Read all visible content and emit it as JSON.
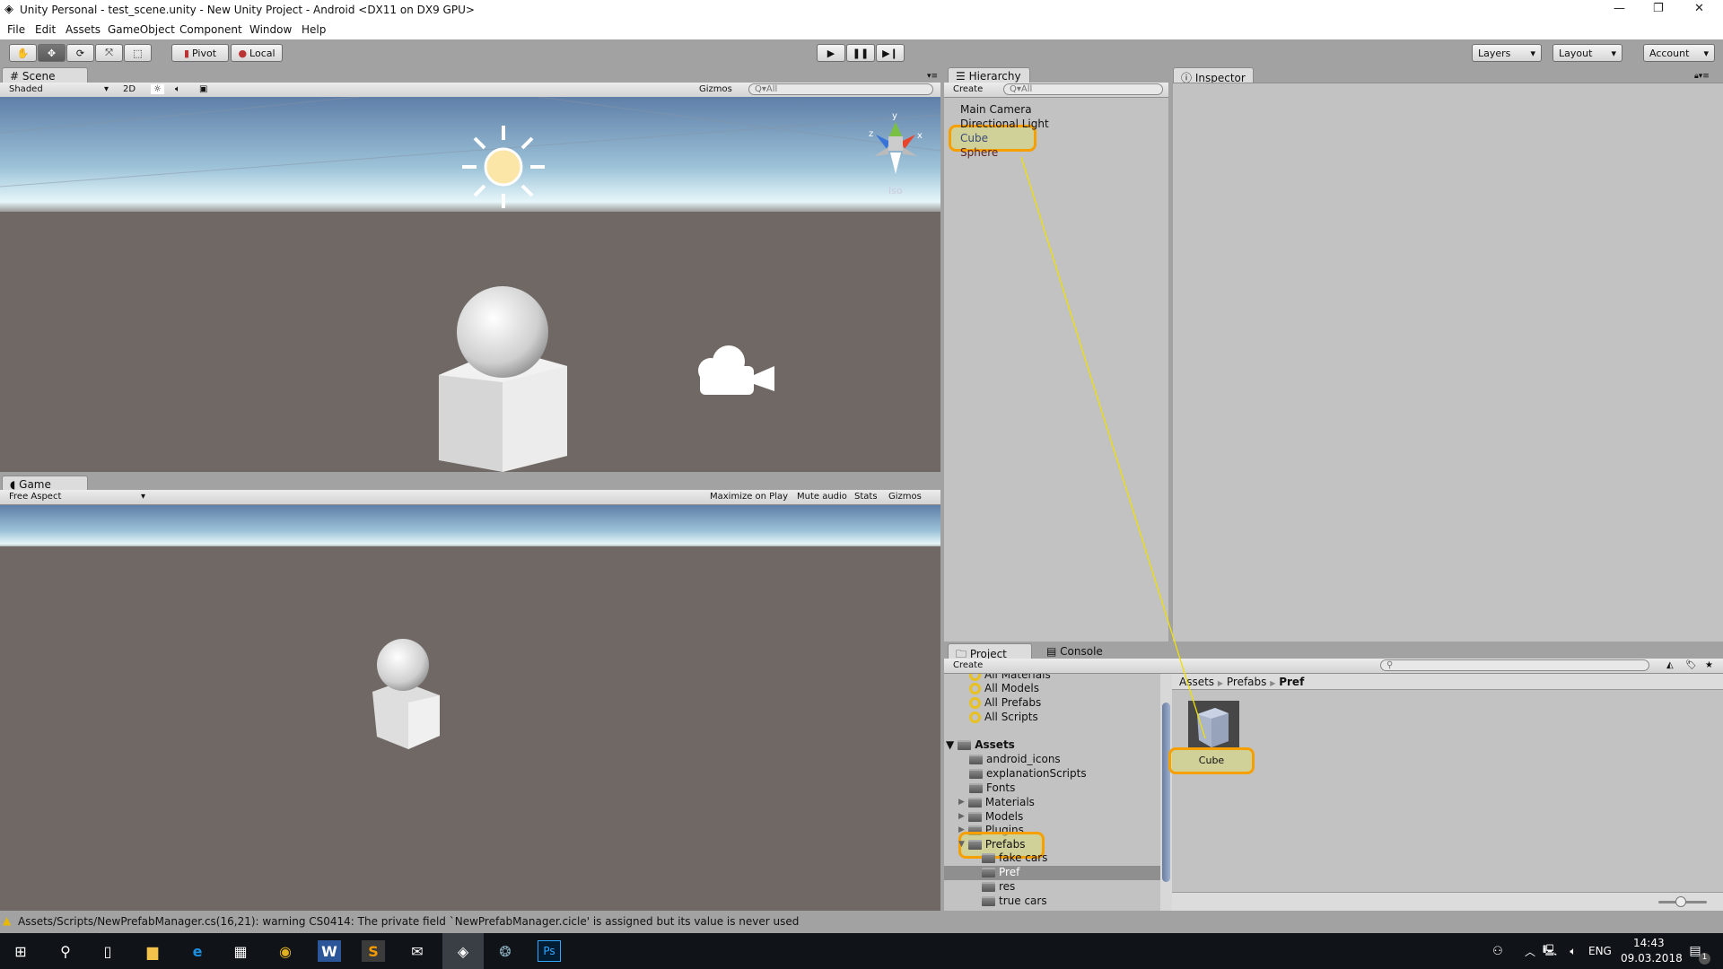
{
  "window": {
    "title": "Unity Personal - test_scene.unity - New Unity Project - Android <DX11 on DX9 GPU>",
    "minimize": "—",
    "restore": "❐",
    "close": "✕"
  },
  "menu": [
    "File",
    "Edit",
    "Assets",
    "GameObject",
    "Component",
    "Window",
    "Help"
  ],
  "toolbar": {
    "pivot": "Pivot",
    "local": "Local",
    "layers": "Layers",
    "layout": "Layout",
    "account": "Account"
  },
  "scene": {
    "tab": "Scene",
    "shading": "Shaded",
    "mode2d": "2D",
    "gizmos": "Gizmos",
    "search_placeholder": "All",
    "gizmo_label": "Iso",
    "axes": {
      "x": "x",
      "y": "y",
      "z": "z"
    }
  },
  "game": {
    "tab": "Game",
    "aspect": "Free Aspect",
    "maximize": "Maximize on Play",
    "mute": "Mute audio",
    "stats": "Stats",
    "gizmos": "Gizmos"
  },
  "hierarchy": {
    "tab": "Hierarchy",
    "create": "Create",
    "search_placeholder": "All",
    "items": [
      "Main Camera",
      "Directional Light",
      "Cube",
      "Sphere"
    ]
  },
  "inspector": {
    "tab": "Inspector"
  },
  "project": {
    "tab": "Project",
    "console_tab": "Console",
    "create": "Create",
    "favorites": [
      "All Materials",
      "All Models",
      "All Prefabs",
      "All Scripts"
    ],
    "root": "Assets",
    "folders": [
      "android_icons",
      "explanationScripts",
      "Fonts",
      "Materials",
      "Models",
      "Plugins",
      "Prefabs"
    ],
    "subfolders": [
      "fake cars",
      "Pref",
      "res",
      "true cars"
    ],
    "breadcrumb": [
      "Assets",
      "Prefabs",
      "Pref"
    ],
    "assets": [
      {
        "name": "Cube"
      }
    ]
  },
  "status": {
    "message": "Assets/Scripts/NewPrefabManager.cs(16,21): warning CS0414: The private field `NewPrefabManager.cicle' is assigned but its value is never used"
  },
  "taskbar": {
    "time": "14:43",
    "date": "09.03.2018",
    "lang": "ENG",
    "notifications": "1"
  },
  "colors": {
    "highlight": "#f5a000",
    "link_line": "#f0e000",
    "ground": "#6f6864"
  }
}
